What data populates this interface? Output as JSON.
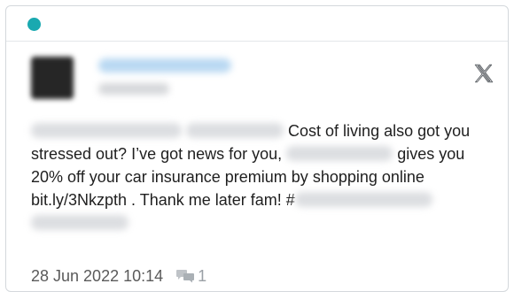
{
  "colors": {
    "status_dot": "#1aa9b0",
    "text": "#1f1f1f",
    "meta_text": "#5a5a5a",
    "icon_gray": "#9aa0a6"
  },
  "header": {
    "status_indicator": "online",
    "source_icon": "x-logo-icon"
  },
  "post": {
    "text_part_1": "Cost of living also got you stressed out? I’ve got news for you,",
    "text_part_2": "gives you 20% off your car insurance premium by shopping online bit.ly/3Nkzpth . Thank me later fam! #",
    "timestamp": "28 Jun 2022 10:14",
    "reply_icon": "comments-icon",
    "reply_count": "1"
  }
}
